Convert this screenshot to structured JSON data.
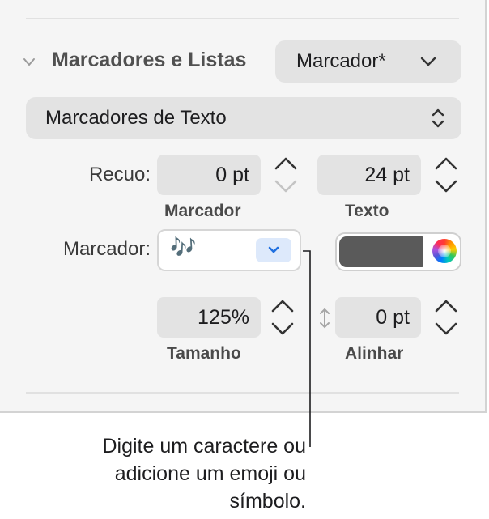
{
  "section": {
    "title": "Marcadores e Listas",
    "collapse_icon": "chevron-down-icon"
  },
  "style_button": {
    "label": "Marcador*",
    "icon": "chevron-down-icon"
  },
  "bullet_type_popup": {
    "value": "Marcadores de Texto",
    "icon": "up-down-chevrons-icon"
  },
  "indent": {
    "label": "Recuo:",
    "bullet_value": "0 pt",
    "bullet_sublabel": "Marcador",
    "text_value": "24 pt",
    "text_sublabel": "Texto"
  },
  "bullet": {
    "label": "Marcador:",
    "glyph": "🎶",
    "dropdown_icon": "chevron-down-icon",
    "color": "#5a5a5a"
  },
  "size": {
    "value": "125%",
    "sublabel": "Tamanho"
  },
  "align": {
    "value": "0 pt",
    "sublabel": "Alinhar",
    "icon": "vertical-align-arrows-icon"
  },
  "callout": {
    "line1": "Digite um caractere ou",
    "line2": "adicione um emoji ou",
    "line3": "símbolo."
  },
  "colors": {
    "accent": "#1f6fe0",
    "panel": "#f5f5f5",
    "control": "#e3e3e3"
  }
}
